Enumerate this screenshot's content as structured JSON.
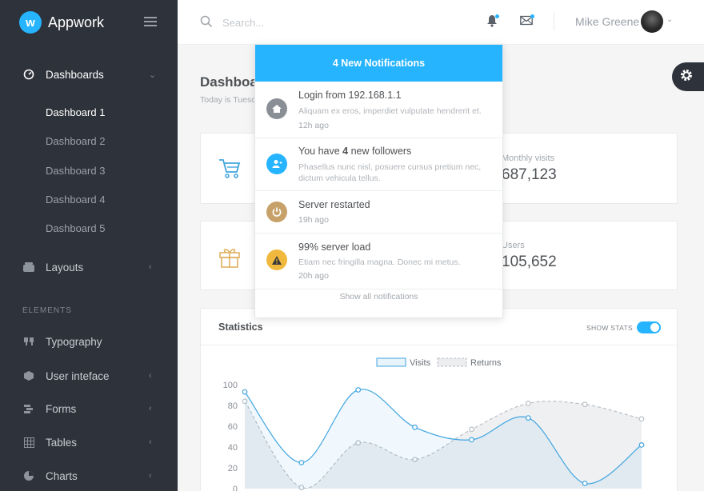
{
  "brand": {
    "name": "Appwork",
    "logo_letter": "w"
  },
  "sidebar": {
    "dashboards": {
      "label": "Dashboards",
      "icon": "speedometer-icon"
    },
    "sub_items": [
      "Dashboard 1",
      "Dashboard 2",
      "Dashboard 3",
      "Dashboard 4",
      "Dashboard 5"
    ],
    "layouts": {
      "label": "Layouts",
      "icon": "layers-icon"
    },
    "section_label": "ELEMENTS",
    "items": [
      {
        "label": "Typography",
        "icon": "quote-icon"
      },
      {
        "label": "User inteface",
        "icon": "cube-icon"
      },
      {
        "label": "Forms",
        "icon": "forms-icon"
      },
      {
        "label": "Tables",
        "icon": "grid-icon"
      },
      {
        "label": "Charts",
        "icon": "pie-chart-icon"
      }
    ]
  },
  "topbar": {
    "search_placeholder": "Search...",
    "user_name": "Mike Greene"
  },
  "page": {
    "title": "Dashboa",
    "subtitle": "Today is Tuesc"
  },
  "stats_cards": [
    {
      "label": "Monthly visits",
      "value": "687,123"
    },
    {
      "label": "Users",
      "value": "105,652"
    }
  ],
  "statistics": {
    "title": "Statistics",
    "show_stats_label": "SHOW STATS",
    "show_stats_on": true
  },
  "notifications": {
    "header": "4 New Notifications",
    "items": [
      {
        "title": "Login from 192.168.1.1",
        "text": "Aliquam ex eros, imperdiet vulputate hendrerit et.",
        "time": "12h ago",
        "icon": "home-icon",
        "color": "#8a8f96"
      },
      {
        "title_pre": "You have ",
        "title_bold": "4",
        "title_post": " new followers",
        "text": "Phasellus nunc nisl, posuere cursus pretium nec, dictum vehicula tellus.",
        "time": "",
        "icon": "user-plus-icon",
        "color": "#26b4ff"
      },
      {
        "title": "Server restarted",
        "text": "",
        "time": "19h ago",
        "icon": "power-icon",
        "color": "#c6a26a"
      },
      {
        "title": "99% server load",
        "text": "Etiam nec fringilla magna. Donec mi metus.",
        "time": "20h ago",
        "icon": "warning-icon",
        "color": "#f0b93e"
      }
    ],
    "footer": "Show all notifications"
  },
  "chart_data": {
    "type": "line",
    "x": [
      0,
      1,
      2,
      3,
      4,
      5,
      6,
      7
    ],
    "series": [
      {
        "name": "Visits",
        "values": [
          93,
          25,
          95,
          59,
          47,
          68,
          5,
          42
        ]
      },
      {
        "name": "Returns",
        "values": [
          84,
          1,
          44,
          28,
          57,
          82,
          81,
          67
        ]
      }
    ],
    "y_ticks": [
      "100",
      "80",
      "60",
      "40",
      "20",
      "0"
    ],
    "ylim": [
      0,
      100
    ],
    "legend": "top-center",
    "colors": {
      "Visits": "#41a5e0",
      "Returns": "#b8bec4"
    }
  }
}
